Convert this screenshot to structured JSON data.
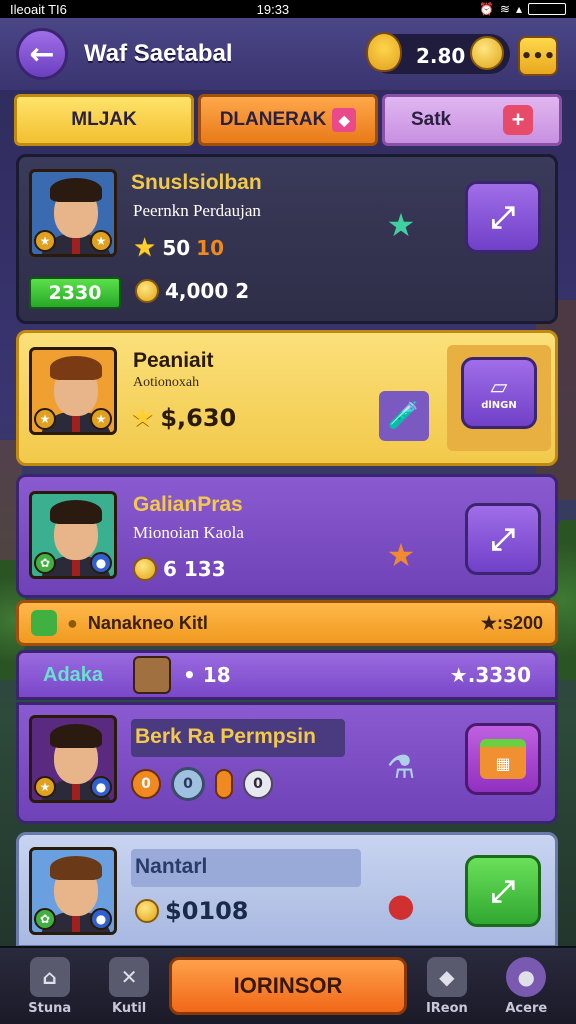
{
  "status_bar": {
    "left": "Ileoait  TI6",
    "time": "19:33"
  },
  "header": {
    "back_glyph": "←",
    "title": "Waf Saetabal",
    "coins": "2.80",
    "menu_glyph": "•••"
  },
  "tabs": [
    {
      "label": "MLJAK"
    },
    {
      "label": "DLANERAK"
    },
    {
      "label": "Satk",
      "plus": "+"
    }
  ],
  "cards": [
    {
      "name": "Snuslsiolban",
      "subtitle": "Peernkn Perdaujan",
      "rating": "50",
      "rating_extra": "10",
      "price": "2330",
      "coins": "4,000 2",
      "item_icon": "★",
      "action_glyph": "⤢"
    },
    {
      "name": "Peaniait",
      "subtitle": "Aotionoxah",
      "rating": "$,630",
      "item_icon": "🧪",
      "action_glyph": "▱",
      "action_caption": "dlNGN"
    },
    {
      "name": "GalianPras",
      "subtitle": "Mionoian Kaola",
      "coins": "6 133",
      "item_icon": "★",
      "action_glyph": "⤢"
    },
    {
      "name": "Berk Ra Permpsin",
      "item_icon": "⚗",
      "action_glyph": "▦",
      "stat_a": "0",
      "stat_b": "0",
      "stat_c": "0"
    },
    {
      "name": "Nantarl",
      "coins": "$0108",
      "item_icon": "●",
      "action_glyph": "⤢"
    }
  ],
  "orange_banner": {
    "text": "Nanakneo Kitl",
    "value": "★:s200"
  },
  "purple_banner": {
    "label": "Adaka",
    "count": "• 18",
    "value": "★.3330"
  },
  "bottom_nav": {
    "left1": "Stuna",
    "left2": "Kutil",
    "cta": "IORINSOR",
    "right1": "IReon",
    "right2": "Acere"
  }
}
